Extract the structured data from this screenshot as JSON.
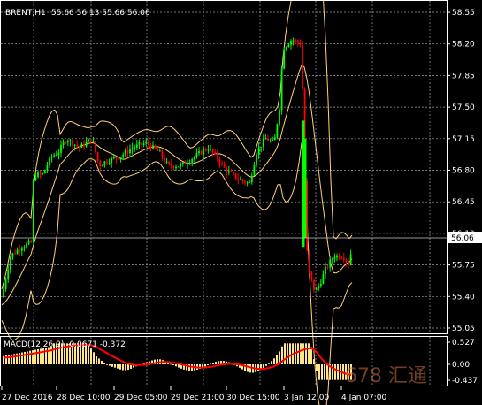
{
  "header": {
    "symbol": "BRENT,H1",
    "ohlc": "55.66 56.13 55.66 56.06"
  },
  "price_badge": "56.06",
  "macd_label": "MACD(12,26,9) -0.0671 -0.372",
  "watermark": "678 汇通",
  "colors": {
    "background": "#000000",
    "bull": "#00ff00",
    "bear": "#ff0000",
    "band": "#ffd37a",
    "grid": "#9aa0a8",
    "histogram": "#ffe68a",
    "signal": "#ff0000"
  },
  "chart_data": [
    {
      "type": "candlestick",
      "title": "BRENT,H1",
      "y_ticks": [
        "58.55",
        "58.20",
        "57.85",
        "57.50",
        "57.15",
        "56.80",
        "56.45",
        "56.10",
        "55.75",
        "55.40",
        "55.05"
      ],
      "x_ticks": [
        "27 Dec 2016",
        "28 Dec 10:00",
        "29 Dec 05:00",
        "29 Dec 21:00",
        "30 Dec 15:00",
        "3 Jan 12:00",
        "4 Jan 07:00"
      ],
      "ylim": [
        55.05,
        58.6
      ],
      "current_price": 56.06,
      "grid": true,
      "indicators": [
        "Bollinger Bands upper",
        "Bollinger Bands middle",
        "Bollinger Bands lower"
      ]
    },
    {
      "type": "histogram",
      "title": "MACD(12,26,9) -0.0671 -0.372",
      "y_ticks": [
        "0.527",
        "0.00",
        "-0.437"
      ],
      "ylim": [
        -0.437,
        0.527
      ],
      "series": [
        {
          "name": "MACD",
          "type": "bar"
        },
        {
          "name": "Signal",
          "type": "line"
        }
      ]
    }
  ]
}
